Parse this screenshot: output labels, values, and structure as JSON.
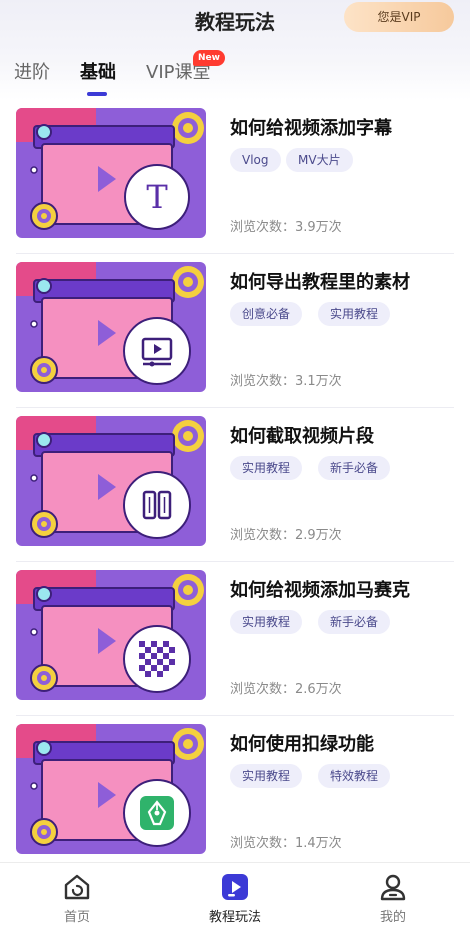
{
  "header": {
    "title": "教程玩法",
    "vip_label": "您是VIP"
  },
  "tabs": [
    {
      "label": "进阶"
    },
    {
      "label": "基础"
    },
    {
      "label": "VIP课堂",
      "badge": "New"
    }
  ],
  "active_tab": "基础",
  "tutorials": [
    {
      "title": "如何给视频添加字幕",
      "tags": [
        "Vlog",
        "MV大片"
      ],
      "views": "浏览次数：3.9万次",
      "icon": "text-t-icon"
    },
    {
      "title": "如何导出教程里的素材",
      "tags": [
        "创意必备",
        "实用教程"
      ],
      "views": "浏览次数：3.1万次",
      "icon": "video-export-icon"
    },
    {
      "title": "如何截取视频片段",
      "tags": [
        "实用教程",
        "新手必备"
      ],
      "views": "浏览次数：2.9万次",
      "icon": "film-clip-icon"
    },
    {
      "title": "如何给视频添加马赛克",
      "tags": [
        "实用教程",
        "新手必备"
      ],
      "views": "浏览次数：2.6万次",
      "icon": "mosaic-icon"
    },
    {
      "title": "如何使用扣绿功能",
      "tags": [
        "实用教程",
        "特效教程"
      ],
      "views": "浏览次数：1.4万次",
      "icon": "pen-nib-icon"
    }
  ],
  "bottom_nav": [
    {
      "label": "首页",
      "icon": "home-icon"
    },
    {
      "label": "教程玩法",
      "icon": "tutorial-play-icon",
      "active": true
    },
    {
      "label": "我的",
      "icon": "profile-icon"
    }
  ],
  "colors": {
    "accent": "#3c3ad6",
    "thumb_bg": "#8e5ed8",
    "thumb_pink": "#e44b8a",
    "thumb_screen": "#f590c0",
    "tag_bg": "#eeeefa",
    "new_badge": "#ff3b30"
  }
}
